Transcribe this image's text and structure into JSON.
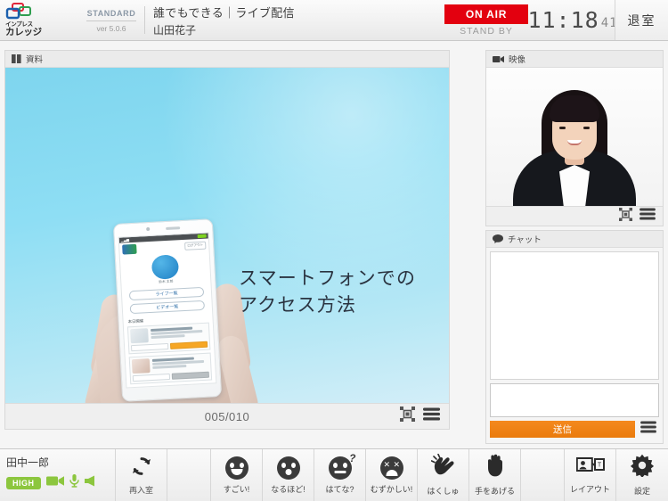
{
  "brand": {
    "line1": "インプレス",
    "line2": "カレッジ",
    "edition": "STANDARD",
    "version": "ver 5.0.6",
    "logo_colors": {
      "blue": "#1b5fad",
      "red": "#e0263a",
      "green": "#2f9e4f"
    }
  },
  "header": {
    "title": "誰でもできる｜ライブ配信",
    "presenter": "山田花子",
    "onair_label": "ON AIR",
    "standby_label": "STAND BY",
    "timer_hm": "11:18",
    "timer_sec": "41",
    "exit_label": "退室",
    "onair_color": "#e3000f"
  },
  "slide_panel": {
    "header_label": "資料",
    "header_icon": "book-icon",
    "page_indicator": "005/010",
    "title_line1": "スマートフォンでの",
    "title_line2": "アクセス方法",
    "fullscreen_icon": "fullscreen-icon",
    "menu_icon": "hamburger-menu-icon",
    "background_color": "#8edef4",
    "phone_app": {
      "logout_label": "ログアウト",
      "user_name": "鈴木 太郎",
      "button_live": "ライブ一覧",
      "button_video": "ビデオ一覧",
      "section_today": "本日開催"
    }
  },
  "video_panel": {
    "header_label": "映像",
    "header_icon": "camcorder-icon",
    "fullscreen_icon": "fullscreen-icon",
    "menu_icon": "hamburger-menu-icon"
  },
  "chat_panel": {
    "header_label": "チャット",
    "header_icon": "speech-bubble-icon",
    "log_text": "",
    "input_value": "",
    "input_placeholder": "",
    "send_label": "送信",
    "send_color": "#ea7b0c",
    "menu_icon": "hamburger-menu-icon"
  },
  "bottom_bar": {
    "user_name": "田中一郎",
    "quality_badge": "HIGH",
    "quality_color": "#8cc63e",
    "device_icons": [
      "camera-icon",
      "microphone-icon",
      "speaker-icon"
    ],
    "rejoin": {
      "label": "再入室",
      "icon": "refresh-icon"
    },
    "reactions": [
      {
        "label": "すごい!",
        "icon": "smiley-happy-icon"
      },
      {
        "label": "なるほど!",
        "icon": "smiley-surprised-icon"
      },
      {
        "label": "はてな?",
        "icon": "smiley-question-icon"
      },
      {
        "label": "むずかしい!",
        "icon": "smiley-confused-icon"
      },
      {
        "label": "はくしゅ",
        "icon": "clapping-hands-icon"
      },
      {
        "label": "手をあげる",
        "icon": "raised-hand-icon"
      }
    ],
    "layout": {
      "label": "レイアウト",
      "icon": "layout-icon"
    },
    "settings": {
      "label": "設定",
      "icon": "gear-icon"
    }
  }
}
